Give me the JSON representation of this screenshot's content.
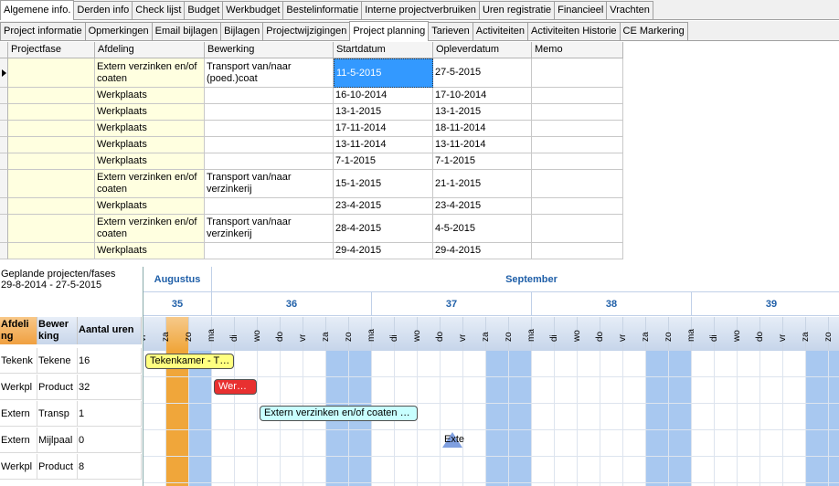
{
  "tabs_top": [
    "Algemene info.",
    "Derden info",
    "Check lijst",
    "Budget",
    "Werkbudget",
    "Bestelinformatie",
    "Interne projectverbruiken",
    "Uren registratie",
    "Financieel",
    "Vrachten"
  ],
  "tabs_sub": [
    "Project informatie",
    "Opmerkingen",
    "Email bijlagen",
    "Bijlagen",
    "Projectwijzigingen",
    "Project planning",
    "Tarieven",
    "Activiteiten",
    "Activiteiten Historie",
    "CE Markering"
  ],
  "grid": {
    "columns": [
      "Projectfase",
      "Afdeling",
      "Bewerking",
      "Startdatum",
      "Opleverdatum",
      "Memo"
    ],
    "rows": [
      {
        "fase": "",
        "afdeling": "Extern verzinken en/of coaten",
        "bewerking": "Transport van/naar (poed.)coat",
        "start": "11-5-2015",
        "oplever": "27-5-2015",
        "memo": ""
      },
      {
        "fase": "",
        "afdeling": "Werkplaats",
        "bewerking": "",
        "start": "16-10-2014",
        "oplever": "17-10-2014",
        "memo": ""
      },
      {
        "fase": "",
        "afdeling": "Werkplaats",
        "bewerking": "",
        "start": "13-1-2015",
        "oplever": "13-1-2015",
        "memo": ""
      },
      {
        "fase": "",
        "afdeling": "Werkplaats",
        "bewerking": "",
        "start": "17-11-2014",
        "oplever": "18-11-2014",
        "memo": ""
      },
      {
        "fase": "",
        "afdeling": "Werkplaats",
        "bewerking": "",
        "start": "13-11-2014",
        "oplever": "13-11-2014",
        "memo": ""
      },
      {
        "fase": "",
        "afdeling": "Werkplaats",
        "bewerking": "",
        "start": "7-1-2015",
        "oplever": "7-1-2015",
        "memo": ""
      },
      {
        "fase": "",
        "afdeling": "Extern verzinken en/of coaten",
        "bewerking": "Transport van/naar verzinkerij",
        "start": "15-1-2015",
        "oplever": "21-1-2015",
        "memo": ""
      },
      {
        "fase": "",
        "afdeling": "Werkplaats",
        "bewerking": "",
        "start": "23-4-2015",
        "oplever": "23-4-2015",
        "memo": ""
      },
      {
        "fase": "",
        "afdeling": "Extern verzinken en/of coaten",
        "bewerking": "Transport van/naar verzinkerij",
        "start": "28-4-2015",
        "oplever": "4-5-2015",
        "memo": ""
      },
      {
        "fase": "",
        "afdeling": "Werkplaats",
        "bewerking": "",
        "start": "29-4-2015",
        "oplever": "29-4-2015",
        "memo": ""
      }
    ]
  },
  "planning": {
    "title": "Geplande projecten/fases",
    "range": "29-8-2014 - 27-5-2015",
    "headers": [
      "Afdeli ng",
      "Bewer king",
      "Aantal uren"
    ],
    "rows": [
      {
        "afdeling": "Tekenk",
        "bewerking": "Tekene",
        "uren": "16"
      },
      {
        "afdeling": "Werkpl",
        "bewerking": "Product",
        "uren": "32"
      },
      {
        "afdeling": "Extern",
        "bewerking": "Transp",
        "uren": "1"
      },
      {
        "afdeling": "Extern",
        "bewerking": "Mijlpaal",
        "uren": "0"
      },
      {
        "afdeling": "Werkpl",
        "bewerking": "Product",
        "uren": "8"
      }
    ]
  },
  "gantt": {
    "months": [
      "Augustus",
      "September"
    ],
    "weeks": [
      "35",
      "36",
      "37",
      "38",
      "39"
    ],
    "days": [
      "vr",
      "za",
      "zo",
      "ma",
      "di",
      "wo",
      "do",
      "vr",
      "za",
      "zo",
      "ma",
      "di",
      "wo",
      "do",
      "vr",
      "za",
      "zo",
      "ma",
      "di",
      "wo",
      "do",
      "vr",
      "za",
      "zo",
      "ma",
      "di",
      "wo",
      "do",
      "vr",
      "za",
      "zo"
    ],
    "bars": {
      "tekenkamer": "Tekenkamer - T…",
      "werkplaats": "Wer…",
      "extern": "Extern verzinken en/of coaten …",
      "milestone": "Exte"
    },
    "colors": {
      "weekend": "#a8c8f0",
      "today": "#f0a63a",
      "header_text": "#1f5fa8"
    }
  }
}
